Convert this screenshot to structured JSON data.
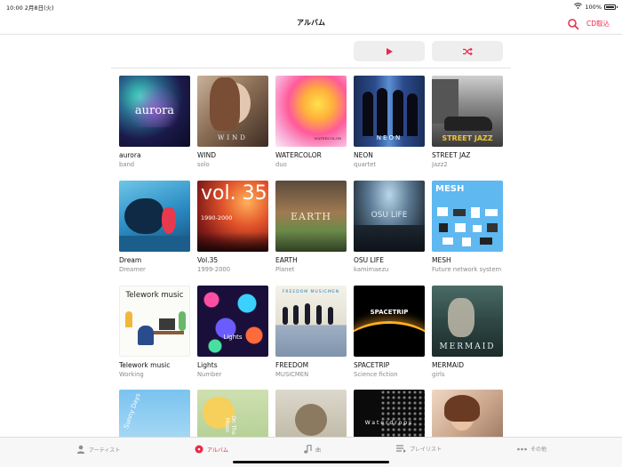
{
  "status_bar": {
    "time_date": "10:00  2月8日(火)",
    "battery": "100%"
  },
  "header": {
    "title": "アルバム",
    "cd_import": "CD取込"
  },
  "actions": {
    "play_icon": "play-icon",
    "shuffle_icon": "shuffle-icon"
  },
  "accent_color": "#e8294a",
  "albums": [
    {
      "title": "aurora",
      "subtitle": "band",
      "cover_text": "aurora"
    },
    {
      "title": "WIND",
      "subtitle": "solo",
      "cover_text": "WIND"
    },
    {
      "title": "WATERCOLOR",
      "subtitle": "duo",
      "cover_text": "WATERCOLOR"
    },
    {
      "title": "NEON",
      "subtitle": "quartet",
      "cover_text": "NEON"
    },
    {
      "title": "STREET JAZ",
      "subtitle": "Jazz2",
      "cover_text": "STREET JAZZ"
    },
    {
      "title": "Dream",
      "subtitle": "Dreamer",
      "cover_text": ""
    },
    {
      "title": "Vol.35",
      "subtitle": "1999-2000",
      "cover_text": "vol. 35",
      "cover_sub": "1990-2000"
    },
    {
      "title": "EARTH",
      "subtitle": "Planet",
      "cover_text": "EARTH"
    },
    {
      "title": "OSU LIFE",
      "subtitle": "kamimaezu",
      "cover_text": "OSU LIFE"
    },
    {
      "title": "MESH",
      "subtitle": "Future network system",
      "cover_text": "MESH"
    },
    {
      "title": "Telework music",
      "subtitle": "Working",
      "cover_text": "Telework music"
    },
    {
      "title": "Lights",
      "subtitle": "Number",
      "cover_text": "Lights"
    },
    {
      "title": "FREEDOM",
      "subtitle": "MUSICMEN",
      "cover_text": "FREEDOM MUSICMEN"
    },
    {
      "title": "SPACETRIP",
      "subtitle": "Science fiction",
      "cover_text": "SPACETRIP"
    },
    {
      "title": "MERMAID",
      "subtitle": "girls",
      "cover_text": "MERMAID"
    },
    {
      "title": "",
      "subtitle": "",
      "cover_text": "Sunny Days"
    },
    {
      "title": "",
      "subtitle": "",
      "cover_text": "On The Moon"
    },
    {
      "title": "",
      "subtitle": "",
      "cover_text": ""
    },
    {
      "title": "",
      "subtitle": "",
      "cover_text": "Waterdrops"
    },
    {
      "title": "",
      "subtitle": "",
      "cover_text": ""
    }
  ],
  "tabs": [
    {
      "label": "アーティスト",
      "icon": "person-icon"
    },
    {
      "label": "アルバム",
      "icon": "album-icon",
      "active": true
    },
    {
      "label": "曲",
      "icon": "music-note-icon"
    },
    {
      "label": "プレイリスト",
      "icon": "playlist-icon"
    },
    {
      "label": "その他",
      "icon": "more-icon"
    }
  ]
}
